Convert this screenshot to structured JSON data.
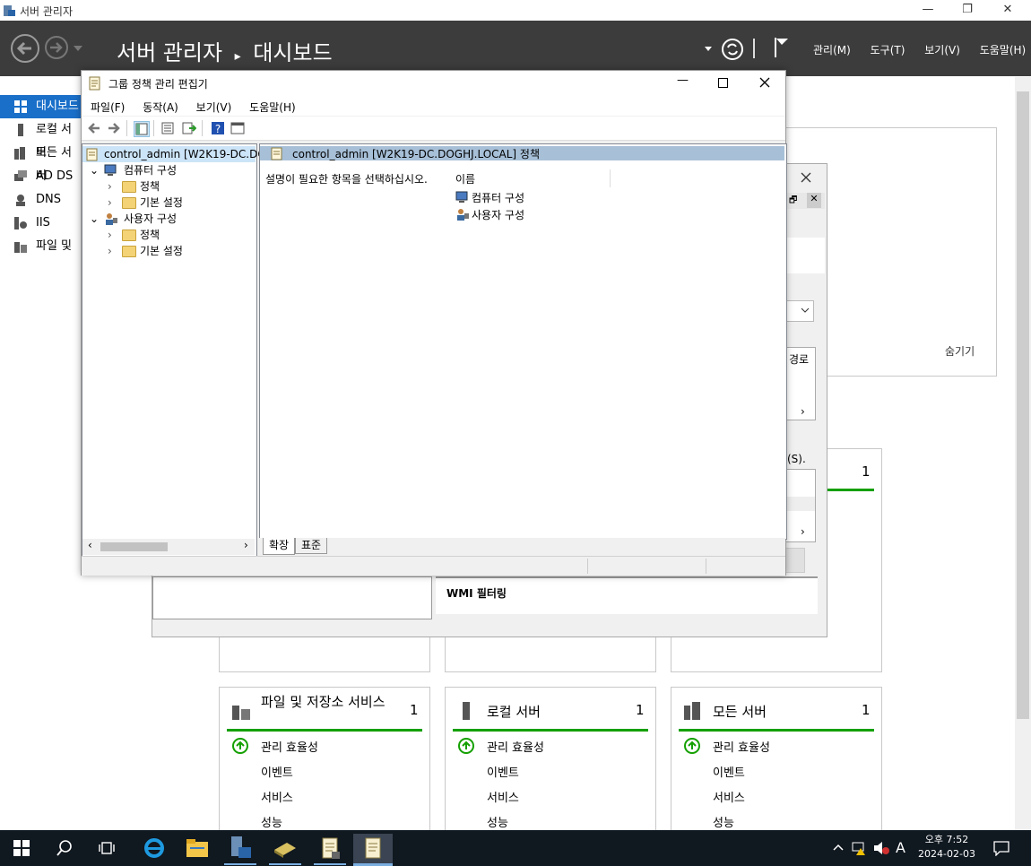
{
  "window": {
    "title": "서버 관리자",
    "controls": {
      "minimize": "—",
      "restore": "❐",
      "close": "✕"
    }
  },
  "header": {
    "breadcrumb_root": "서버 관리자",
    "breadcrumb_sep": "▸",
    "breadcrumb_page": "대시보드",
    "menu": [
      "관리(M)",
      "도구(T)",
      "보기(V)",
      "도움말(H)"
    ]
  },
  "nav": {
    "items": [
      {
        "label": "대시보드",
        "icon": "dashboard-icon"
      },
      {
        "label": "로컬 서버",
        "icon": "server-icon"
      },
      {
        "label": "모든 서버",
        "icon": "servers-icon"
      },
      {
        "label": "AD DS",
        "icon": "ad-icon"
      },
      {
        "label": "DNS",
        "icon": "dns-icon"
      },
      {
        "label": "IIS",
        "icon": "iis-icon"
      },
      {
        "label": "파일 및",
        "icon": "file-storage-icon"
      }
    ]
  },
  "welcome_panel": {
    "hide_label": "숨기기"
  },
  "behind_dialog": {
    "path_label": "경로",
    "s_label": "(S).",
    "wmi_label": "WMI 필터링"
  },
  "tiles_top": [
    {
      "count": "1"
    }
  ],
  "tiles": [
    {
      "title": "파일 및 저장소 서비스",
      "count": "1",
      "rows": [
        "관리 효율성",
        "이벤트",
        "서비스",
        "성능"
      ]
    },
    {
      "title": "로컬 서버",
      "count": "1",
      "rows": [
        "관리 효율성",
        "이벤트",
        "서비스",
        "성능"
      ]
    },
    {
      "title": "모든 서버",
      "count": "1",
      "rows": [
        "관리 효율성",
        "이벤트",
        "서비스",
        "성능"
      ]
    }
  ],
  "gpme": {
    "title": "그룹 정책 관리 편집기",
    "menu": [
      "파일(F)",
      "동작(A)",
      "보기(V)",
      "도움말(H)"
    ],
    "tree": {
      "root": "control_admin [W2K19-DC.DO",
      "computer_config": "컴퓨터 구성",
      "user_config": "사용자 구성",
      "policies": "정책",
      "prefs": "기본 설정"
    },
    "right": {
      "header": "control_admin [W2K19-DC.DOGHJ.LOCAL] 정책",
      "description": "설명이 필요한 항목을 선택하십시오.",
      "col_name": "이름",
      "items": [
        "컴퓨터 구성",
        "사용자 구성"
      ],
      "tab_extended": "확장",
      "tab_standard": "표준"
    }
  },
  "taskbar": {
    "time": "오후 7:52",
    "date": "2024-02-03",
    "ime": "A"
  }
}
